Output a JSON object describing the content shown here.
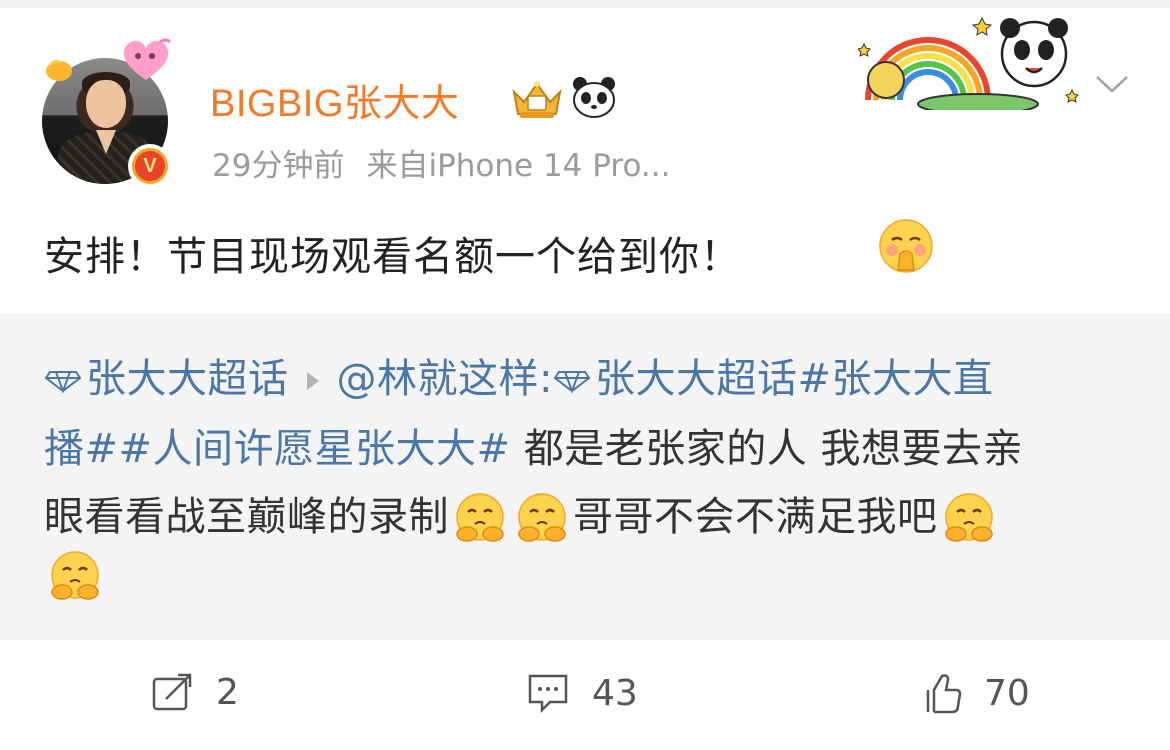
{
  "user": {
    "name": "BIGBIG张大大",
    "time": "29分钟前",
    "source": "来自iPhone 14 Pro...",
    "verified_mark": "V"
  },
  "post": {
    "text": "安排！节目现场观看名额一个给到你！"
  },
  "retweet": {
    "topic1": "张大大超话",
    "mention": "@林就这样:",
    "topic2": "张大大超话",
    "hashtag1": "#张大大直",
    "hashtag1_cont": "播#",
    "hashtag2": "#人间许愿星张大大#",
    "text_a": " 都是老张家的人 我想要去亲",
    "text_b": "眼看看战至巅峰的录制",
    "text_c": "哥哥不会不满足我吧"
  },
  "actions": {
    "repost_count": "2",
    "comment_count": "43",
    "like_count": "70"
  },
  "colors": {
    "username": "#f47a2a",
    "link": "#4a76a8",
    "meta": "#9b9b9b",
    "retweet_bg": "#f4f4f4"
  },
  "icons": [
    "heart-badge-icon",
    "bird-badge-icon",
    "verified-icon",
    "crown-icon",
    "panda-icon",
    "rainbow-panda-sticker",
    "chevron-down-icon",
    "shy-emoji-icon",
    "diamond-icon",
    "repost-icon",
    "comment-icon",
    "like-icon"
  ]
}
